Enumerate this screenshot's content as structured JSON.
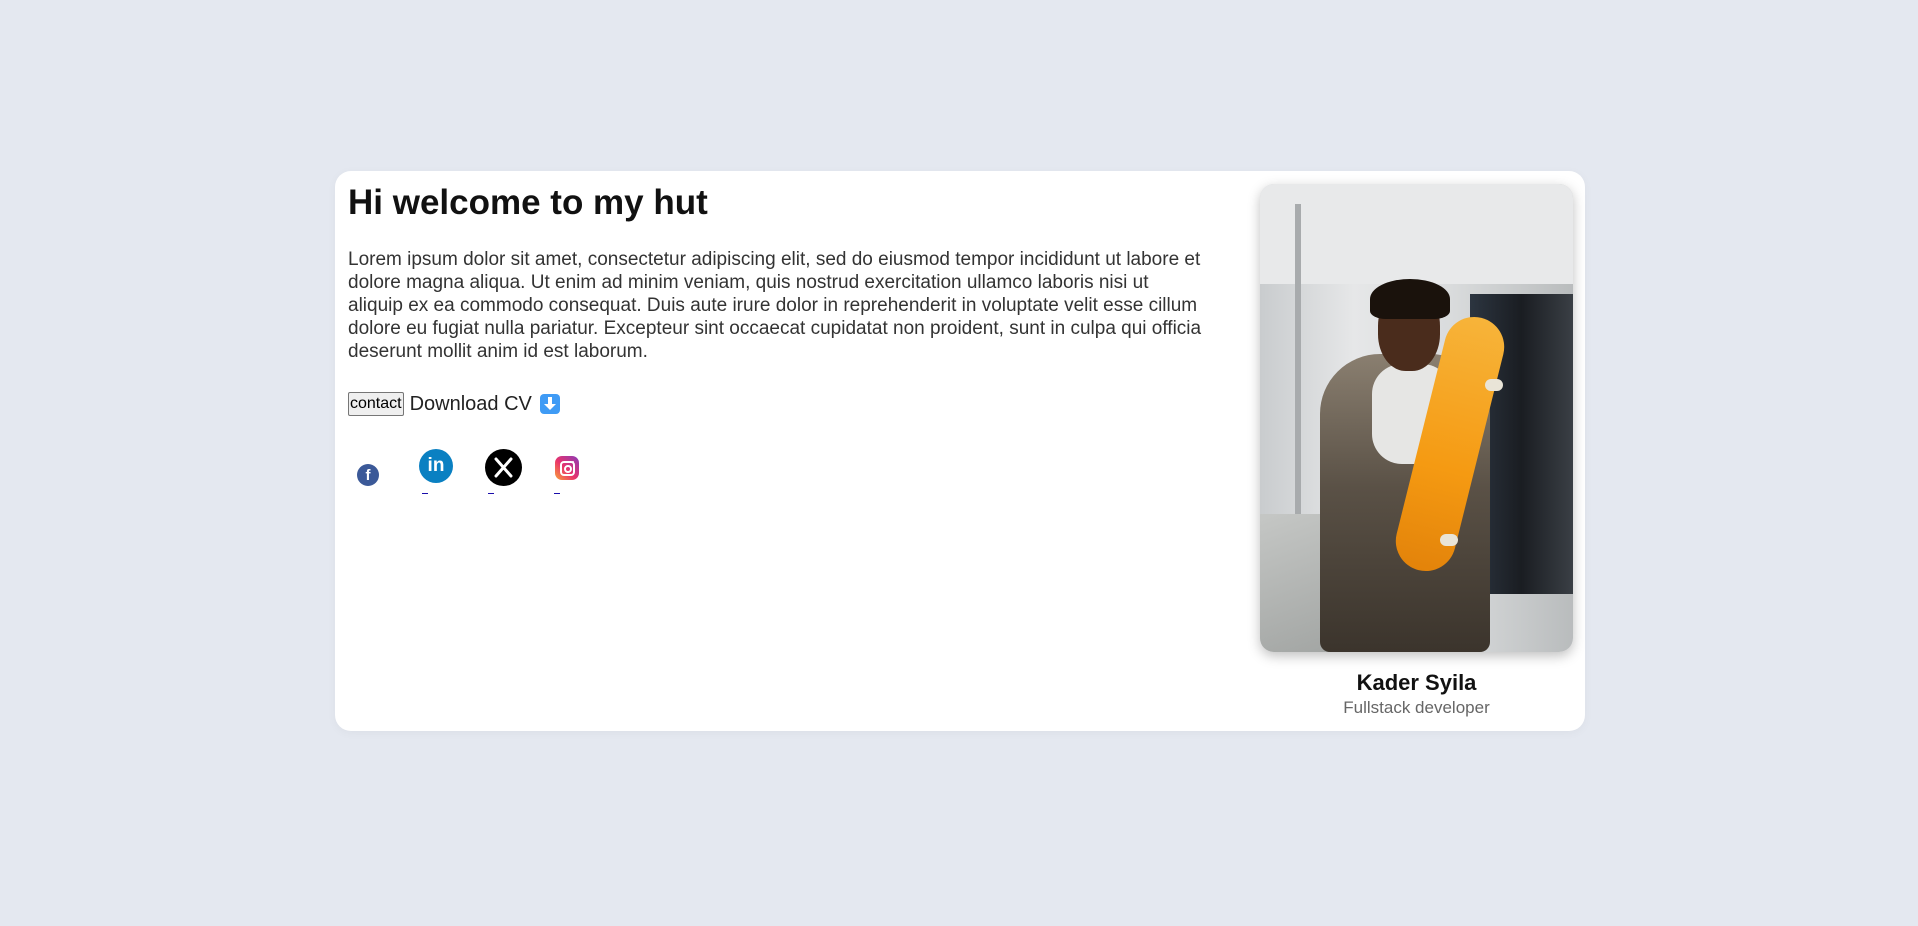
{
  "hero": {
    "title": "Hi welcome to my hut",
    "intro": "Lorem ipsum dolor sit amet, consectetur adipiscing elit, sed do eiusmod tempor incididunt ut labore et dolore magna aliqua. Ut enim ad minim veniam, quis nostrud exercitation ullamco laboris nisi ut aliquip ex ea commodo consequat. Duis aute irure dolor in reprehenderit in voluptate velit esse cillum dolore eu fugiat nulla pariatur. Excepteur sint occaecat cupidatat non proident, sunt in culpa qui officia deserunt mollit anim id est laborum.",
    "contact_label": "contact",
    "download_label": "Download CV",
    "download_icon": "down-arrow-icon"
  },
  "socials": [
    {
      "name": "facebook",
      "icon": "facebook-icon",
      "glyph": "f",
      "color": "#3b5998"
    },
    {
      "name": "linkedin",
      "icon": "linkedin-icon",
      "glyph": "in",
      "color": "#0a80c2"
    },
    {
      "name": "x",
      "icon": "x-icon",
      "color": "#000000"
    },
    {
      "name": "instagram",
      "icon": "instagram-icon"
    }
  ],
  "profile": {
    "name": "Kader Syila",
    "role": "Fullstack developer"
  },
  "colors": {
    "background": "#e4e8f0",
    "card": "#ffffff",
    "accent": "#3f9bf5"
  }
}
